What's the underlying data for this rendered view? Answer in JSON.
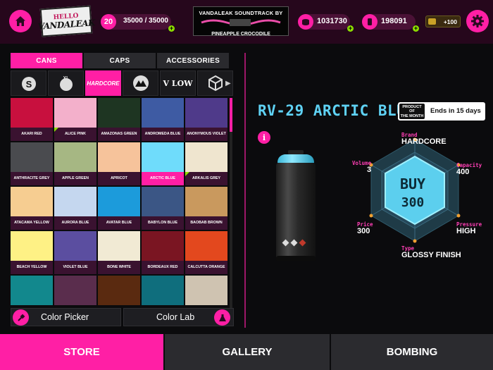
{
  "topbar": {
    "logo_line1": "HELLO",
    "logo_line2": "VANDALEAK",
    "level": "20",
    "xp": "35000 / 35000",
    "soundtrack_line1": "VANDALEAK SOUNDTRACK BY",
    "soundtrack_line2": "PINEAPPLE CROCODILE",
    "coins": "1031730",
    "gems": "198091",
    "video_reward": "+100"
  },
  "tabs": [
    {
      "label": "CANS"
    },
    {
      "label": "CAPS"
    },
    {
      "label": "ACCESSORIES"
    }
  ],
  "brands": [
    "S",
    "XL",
    "HARDCORE",
    "MTN",
    "V LOW",
    "CUBE"
  ],
  "swatches": [
    {
      "name": "AKARI RED",
      "color": "#c8103e"
    },
    {
      "name": "ALICE PINK",
      "color": "#f3b0cb"
    },
    {
      "name": "AMAZONAS GREEN",
      "color": "#1e3522"
    },
    {
      "name": "ANDROMEDA BLUE",
      "color": "#3e5ba3"
    },
    {
      "name": "ANONYMOUS VIOLET",
      "color": "#4f3a8a"
    },
    {
      "name": "ANTHRACITE GREY",
      "color": "#4a4b4f"
    },
    {
      "name": "APPLE GREEN",
      "color": "#a6b783"
    },
    {
      "name": "APRICOT",
      "color": "#f6c39b"
    },
    {
      "name": "ARCTIC BLUE",
      "color": "#6fdcfb"
    },
    {
      "name": "ARKALIS GREY",
      "color": "#efe5cf"
    },
    {
      "name": "ATACAMA YELLOW",
      "color": "#f6cd91"
    },
    {
      "name": "AURORA BLUE",
      "color": "#c5d7ef"
    },
    {
      "name": "AVATAR BLUE",
      "color": "#1c9bdb"
    },
    {
      "name": "BABYLON BLUE",
      "color": "#3b5685"
    },
    {
      "name": "BAOBAB BROWN",
      "color": "#c9995e"
    },
    {
      "name": "BEACH YELLOW",
      "color": "#fef185"
    },
    {
      "name": "VIOLET BLUE",
      "color": "#5b4ea0"
    },
    {
      "name": "BONE WHITE",
      "color": "#f1ead4"
    },
    {
      "name": "BORDEAUX RED",
      "color": "#7a1522"
    },
    {
      "name": "CALCUTTA ORANGE",
      "color": "#e3481e"
    },
    {
      "name": "",
      "color": "#12888d"
    },
    {
      "name": "",
      "color": "#5a2d4d"
    },
    {
      "name": "",
      "color": "#5a2a10"
    },
    {
      "name": "",
      "color": "#0f6e7d"
    },
    {
      "name": "",
      "color": "#cfc3b1"
    }
  ],
  "tools": {
    "color_picker": "Color Picker",
    "color_lab": "Color Lab"
  },
  "product": {
    "title": "RV-29 ARCTIC BLUE",
    "potm_line1": "PRODUCT OF",
    "potm_line2": "THE MONTH",
    "ends": "Ends in 15 days",
    "buy_label": "BUY",
    "price": "300",
    "stats": {
      "brand_label": "Brand",
      "brand_value": "HARDCORE",
      "capacity_label": "Capacity",
      "capacity_value": "400",
      "pressure_label": "Pressure",
      "pressure_value": "HIGH",
      "type_label": "Type",
      "type_value": "GLOSSY FINISH",
      "price_label": "Price",
      "price_value": "300",
      "volume_label": "Volume",
      "volume_value": "3"
    }
  },
  "nav": [
    {
      "label": "STORE"
    },
    {
      "label": "GALLERY"
    },
    {
      "label": "BOMBING"
    }
  ],
  "colors": {
    "accent": "#ff1fa5",
    "title_blue": "#5fd2f4"
  }
}
